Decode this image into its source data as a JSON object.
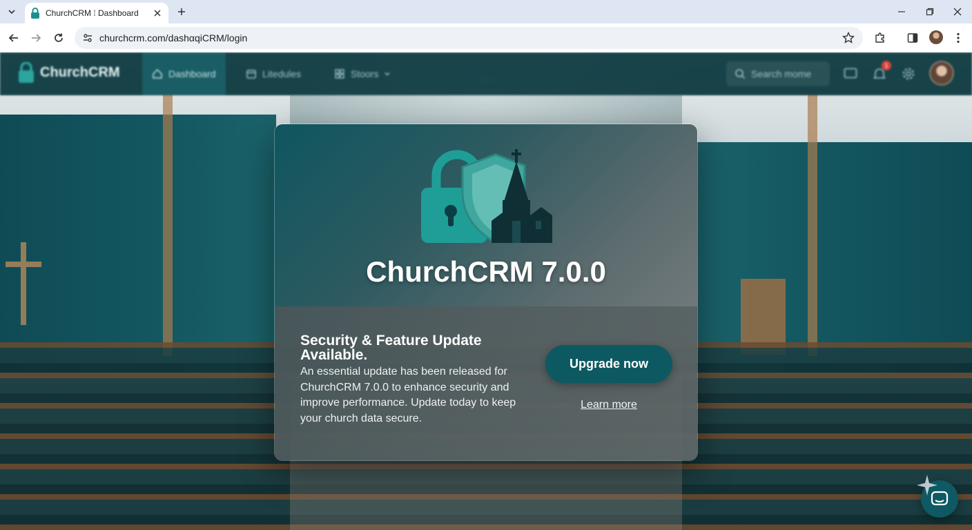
{
  "browser": {
    "tab_title": "ChurchCRM ⁞ Dashboard",
    "url": "churchcrm.com/dashαqiCRM/login"
  },
  "app": {
    "logo_text": "ChurchCRM",
    "nav": [
      {
        "label": "Dashboard",
        "icon": "home-icon"
      },
      {
        "label": "Litedules",
        "icon": "calendar-icon"
      },
      {
        "label": "Stoors",
        "icon": "grid-icon"
      }
    ],
    "search_placeholder": "Search mome",
    "notification_count": "1"
  },
  "modal": {
    "title": "ChurchCRM 7.0.0",
    "heading": "Security & Feature Update Available.",
    "body": "An essential update has been released for ChurchCRM 7.0.0 to enhance security and improve performance. Update today to keep your church data secure.",
    "primary_button": "Upgrade now",
    "secondary_link": "Learn more"
  },
  "colors": {
    "brand_teal": "#0d5962",
    "accent_teal": "#1f8a8c"
  }
}
